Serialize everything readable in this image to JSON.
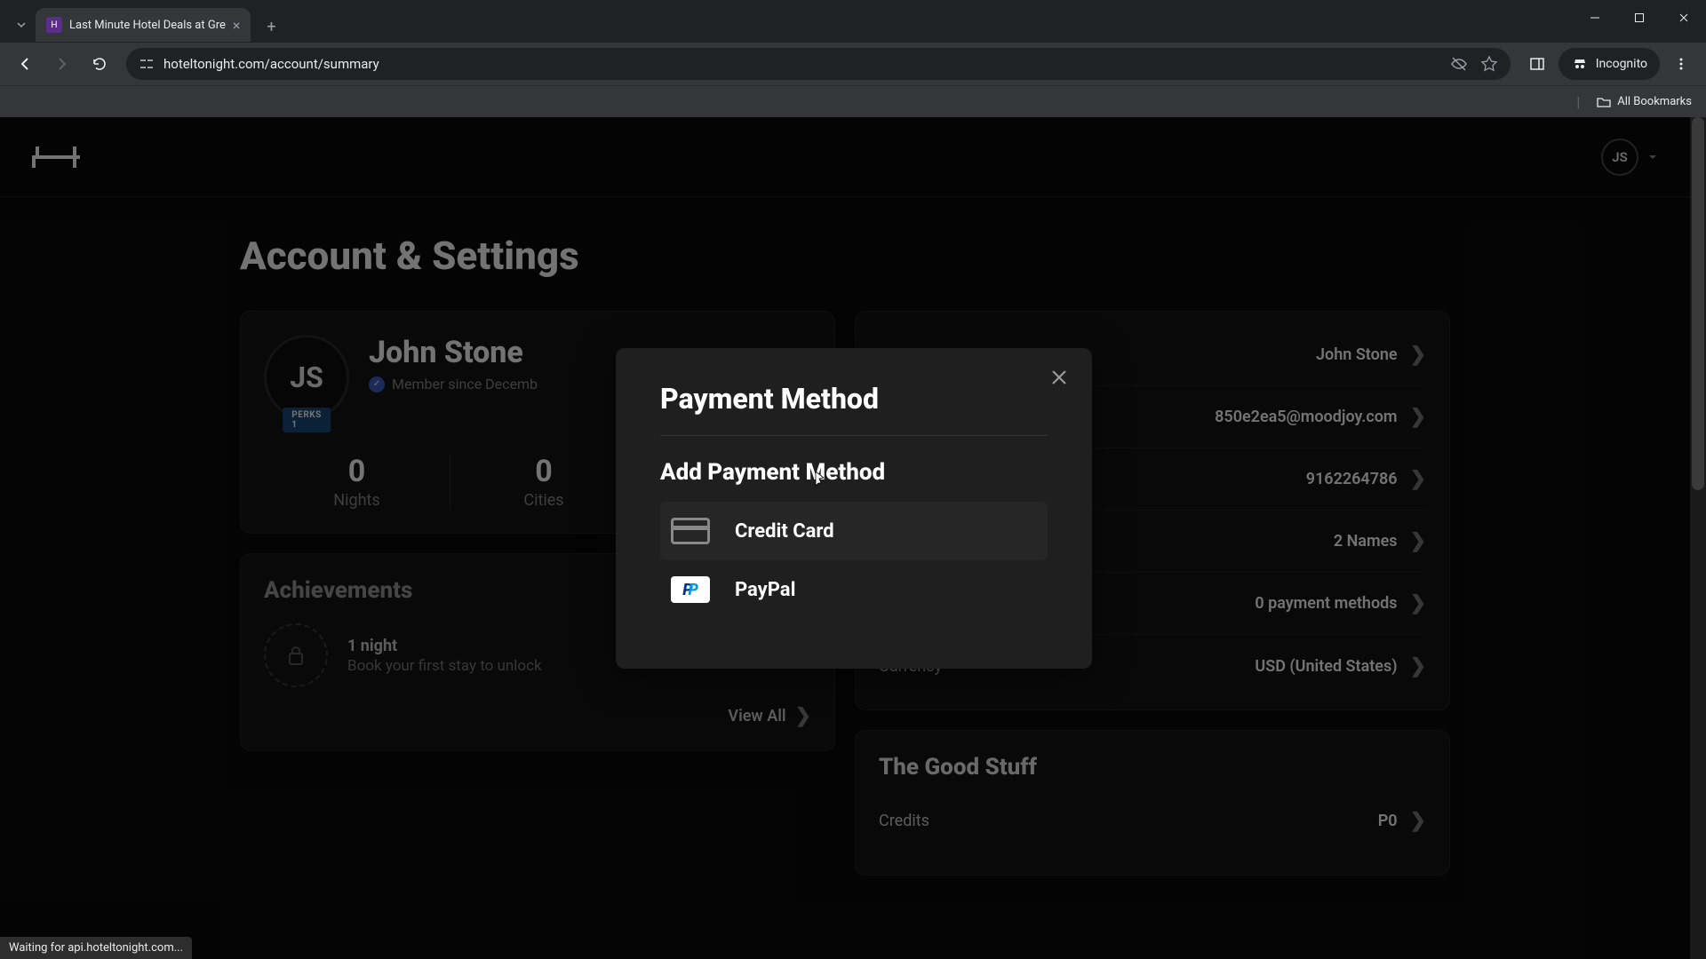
{
  "browser": {
    "tab_title": "Last Minute Hotel Deals at Gre",
    "url": "hoteltonight.com/account/summary",
    "incognito_label": "Incognito",
    "all_bookmarks": "All Bookmarks",
    "status_text": "Waiting for api.hoteltonight.com..."
  },
  "header": {
    "user_initials": "JS"
  },
  "page": {
    "title": "Account & Settings"
  },
  "profile": {
    "initials": "JS",
    "name": "John Stone",
    "member_since": "Member since Decemb",
    "perks_badge": "PERKS 1",
    "stats": [
      {
        "value": "0",
        "label": "Nights"
      },
      {
        "value": "0",
        "label": "Cities"
      }
    ]
  },
  "achievements": {
    "title": "Achievements",
    "item_title": "1 night",
    "item_sub": "Book your first stay to unlock",
    "view_all": "View All"
  },
  "settings_rows": [
    {
      "value": "John Stone"
    },
    {
      "value": "850e2ea5@moodjoy.com"
    },
    {
      "value": "9162264786"
    },
    {
      "value": "2 Names"
    },
    {
      "value": "0 payment methods"
    },
    {
      "label": "Currency",
      "value": "USD (United States)"
    }
  ],
  "good_stuff": {
    "title": "The Good Stuff",
    "credits_label": "Credits",
    "credits_value": "P0"
  },
  "modal": {
    "title": "Payment Method",
    "subtitle": "Add Payment Method",
    "option_cc": "Credit Card",
    "option_pp": "PayPal"
  }
}
